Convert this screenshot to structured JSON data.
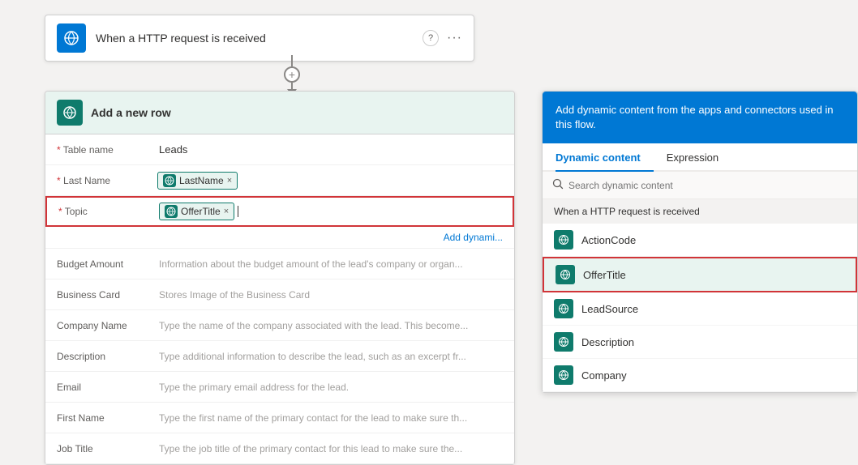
{
  "httpTrigger": {
    "title": "When a HTTP request is received",
    "helpIcon": "?",
    "moreIcon": "..."
  },
  "connector": {
    "plusLabel": "+",
    "arrowLabel": "▼"
  },
  "addRowCard": {
    "title": "Add a new row",
    "fields": [
      {
        "label": "Table name",
        "required": true,
        "type": "text",
        "value": "Leads"
      },
      {
        "label": "Last Name",
        "required": true,
        "type": "tag",
        "tag": "LastName"
      },
      {
        "label": "Topic",
        "required": true,
        "type": "tag",
        "tag": "OfferTitle",
        "highlighted": true
      },
      {
        "label": "",
        "type": "add-dynamic",
        "value": "Add dynami..."
      },
      {
        "label": "Budget Amount",
        "required": false,
        "type": "placeholder",
        "value": "Information about the budget amount of the lead's company or organ..."
      },
      {
        "label": "Business Card",
        "required": false,
        "type": "placeholder",
        "value": "Stores Image of the Business Card"
      },
      {
        "label": "Company Name",
        "required": false,
        "type": "placeholder",
        "value": "Type the name of the company associated with the lead. This become..."
      },
      {
        "label": "Description",
        "required": false,
        "type": "placeholder",
        "value": "Type additional information to describe the lead, such as an excerpt fr..."
      },
      {
        "label": "Email",
        "required": false,
        "type": "placeholder",
        "value": "Type the primary email address for the lead."
      },
      {
        "label": "First Name",
        "required": false,
        "type": "placeholder",
        "value": "Type the first name of the primary contact for the lead to make sure th..."
      },
      {
        "label": "Job Title",
        "required": false,
        "type": "placeholder",
        "value": "Type the job title of the primary contact for this lead to make sure the..."
      }
    ]
  },
  "dynamicPanel": {
    "headerText": "Add dynamic content from the apps and connectors used in this flow.",
    "tabs": [
      {
        "label": "Dynamic content",
        "active": true
      },
      {
        "label": "Expression",
        "active": false
      }
    ],
    "searchPlaceholder": "Search dynamic content",
    "sectionHeader": "When a HTTP request is received",
    "items": [
      {
        "label": "ActionCode",
        "highlighted": false
      },
      {
        "label": "OfferTitle",
        "highlighted": true
      },
      {
        "label": "LeadSource",
        "highlighted": false
      },
      {
        "label": "Description",
        "highlighted": false
      },
      {
        "label": "Company",
        "highlighted": false
      }
    ]
  }
}
